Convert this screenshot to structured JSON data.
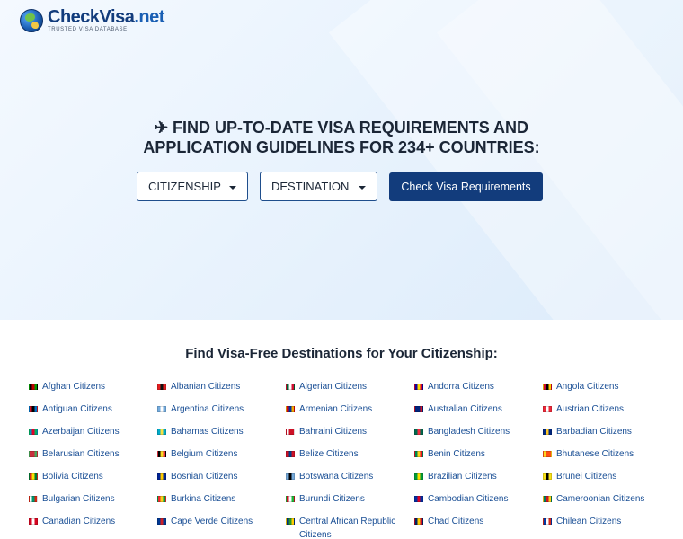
{
  "brand": {
    "name": "CheckVisa",
    "tld": ".net",
    "tagline": "TRUSTED VISA DATABASE"
  },
  "hero": {
    "headline_line1": "✈ FIND UP-TO-DATE VISA REQUIREMENTS AND",
    "headline_line2": "APPLICATION GUIDELINES FOR 234+ COUNTRIES:",
    "citizenship_label": "CITIZENSHIP",
    "destination_label": "DESTINATION",
    "check_button_label": "Check Visa Requirements"
  },
  "visa_free": {
    "title": "Find Visa-Free Destinations for Your Citizenship:",
    "items": [
      {
        "label": "Afghan Citizens",
        "flag": "afghanistan-flag-icon",
        "colors": [
          "#000000",
          "#bf0000",
          "#009900"
        ]
      },
      {
        "label": "Albanian Citizens",
        "flag": "albania-flag-icon",
        "colors": [
          "#e41e20",
          "#111111",
          "#e41e20"
        ]
      },
      {
        "label": "Algerian Citizens",
        "flag": "algeria-flag-icon",
        "colors": [
          "#006233",
          "#ffffff",
          "#d21034"
        ]
      },
      {
        "label": "Andorra Citizens",
        "flag": "andorra-flag-icon",
        "colors": [
          "#10069f",
          "#fedd00",
          "#d50032"
        ]
      },
      {
        "label": "Angola Citizens",
        "flag": "angola-flag-icon",
        "colors": [
          "#cc092f",
          "#000000",
          "#ffcb00"
        ]
      },
      {
        "label": "Antiguan Citizens",
        "flag": "antigua-flag-icon",
        "colors": [
          "#ce1126",
          "#000000",
          "#0072c6"
        ]
      },
      {
        "label": "Argentina Citizens",
        "flag": "argentina-flag-icon",
        "colors": [
          "#74acdf",
          "#ffffff",
          "#74acdf"
        ]
      },
      {
        "label": "Armenian Citizens",
        "flag": "armenia-flag-icon",
        "colors": [
          "#d90012",
          "#0033a0",
          "#f2a800"
        ]
      },
      {
        "label": "Australian Citizens",
        "flag": "australia-flag-icon",
        "colors": [
          "#00247d",
          "#00247d",
          "#cf142b"
        ]
      },
      {
        "label": "Austrian Citizens",
        "flag": "austria-flag-icon",
        "colors": [
          "#ed2939",
          "#ffffff",
          "#ed2939"
        ]
      },
      {
        "label": "Azerbaijan Citizens",
        "flag": "azerbaijan-flag-icon",
        "colors": [
          "#0092bc",
          "#e4002b",
          "#00af66"
        ]
      },
      {
        "label": "Bahamas Citizens",
        "flag": "bahamas-flag-icon",
        "colors": [
          "#00abc9",
          "#fae042",
          "#00abc9"
        ]
      },
      {
        "label": "Bahraini Citizens",
        "flag": "bahrain-flag-icon",
        "colors": [
          "#ffffff",
          "#ce1126",
          "#ce1126"
        ]
      },
      {
        "label": "Bangladesh Citizens",
        "flag": "bangladesh-flag-icon",
        "colors": [
          "#006a4e",
          "#f42a41",
          "#006a4e"
        ]
      },
      {
        "label": "Barbadian Citizens",
        "flag": "barbados-flag-icon",
        "colors": [
          "#00267f",
          "#ffc726",
          "#00267f"
        ]
      },
      {
        "label": "Belarusian Citizens",
        "flag": "belarus-flag-icon",
        "colors": [
          "#c8313e",
          "#c8313e",
          "#4aa657"
        ]
      },
      {
        "label": "Belgium Citizens",
        "flag": "belgium-flag-icon",
        "colors": [
          "#000000",
          "#fdda24",
          "#ef3340"
        ]
      },
      {
        "label": "Belize Citizens",
        "flag": "belize-flag-icon",
        "colors": [
          "#ce1126",
          "#003f87",
          "#ce1126"
        ]
      },
      {
        "label": "Benin Citizens",
        "flag": "benin-flag-icon",
        "colors": [
          "#008751",
          "#fcd116",
          "#e8112d"
        ]
      },
      {
        "label": "Bhutanese Citizens",
        "flag": "bhutan-flag-icon",
        "colors": [
          "#ffd520",
          "#ff4e12",
          "#ff4e12"
        ]
      },
      {
        "label": "Bolivia Citizens",
        "flag": "bolivia-flag-icon",
        "colors": [
          "#d52b1e",
          "#f9e300",
          "#007934"
        ]
      },
      {
        "label": "Bosnian Citizens",
        "flag": "bosnia-flag-icon",
        "colors": [
          "#002395",
          "#fecb00",
          "#002395"
        ]
      },
      {
        "label": "Botswana Citizens",
        "flag": "botswana-flag-icon",
        "colors": [
          "#75aadb",
          "#000000",
          "#75aadb"
        ]
      },
      {
        "label": "Brazilian Citizens",
        "flag": "brazil-flag-icon",
        "colors": [
          "#009c3b",
          "#ffdf00",
          "#009c3b"
        ]
      },
      {
        "label": "Brunei Citizens",
        "flag": "brunei-flag-icon",
        "colors": [
          "#f7e017",
          "#000000",
          "#f7e017"
        ]
      },
      {
        "label": "Bulgarian Citizens",
        "flag": "bulgaria-flag-icon",
        "colors": [
          "#ffffff",
          "#00966e",
          "#d62612"
        ]
      },
      {
        "label": "Burkina Citizens",
        "flag": "burkina-faso-flag-icon",
        "colors": [
          "#ef2b2d",
          "#fcd116",
          "#009e49"
        ]
      },
      {
        "label": "Burundi Citizens",
        "flag": "burundi-flag-icon",
        "colors": [
          "#ce1126",
          "#ffffff",
          "#1eb53a"
        ]
      },
      {
        "label": "Cambodian Citizens",
        "flag": "cambodia-flag-icon",
        "colors": [
          "#032ea1",
          "#e00025",
          "#032ea1"
        ]
      },
      {
        "label": "Cameroonian Citizens",
        "flag": "cameroon-flag-icon",
        "colors": [
          "#007a5e",
          "#ce1126",
          "#fcd116"
        ]
      },
      {
        "label": "Canadian Citizens",
        "flag": "canada-flag-icon",
        "colors": [
          "#d80621",
          "#ffffff",
          "#d80621"
        ]
      },
      {
        "label": "Cape Verde Citizens",
        "flag": "cape-verde-flag-icon",
        "colors": [
          "#003893",
          "#cf2027",
          "#003893"
        ]
      },
      {
        "label": "Central African Republic Citizens",
        "flag": "central-african-republic-flag-icon",
        "colors": [
          "#003082",
          "#289728",
          "#ffce00"
        ]
      },
      {
        "label": "Chad Citizens",
        "flag": "chad-flag-icon",
        "colors": [
          "#002664",
          "#fecb00",
          "#c60c30"
        ]
      },
      {
        "label": "Chilean Citizens",
        "flag": "chile-flag-icon",
        "colors": [
          "#0039a6",
          "#ffffff",
          "#d52b1e"
        ]
      }
    ]
  }
}
